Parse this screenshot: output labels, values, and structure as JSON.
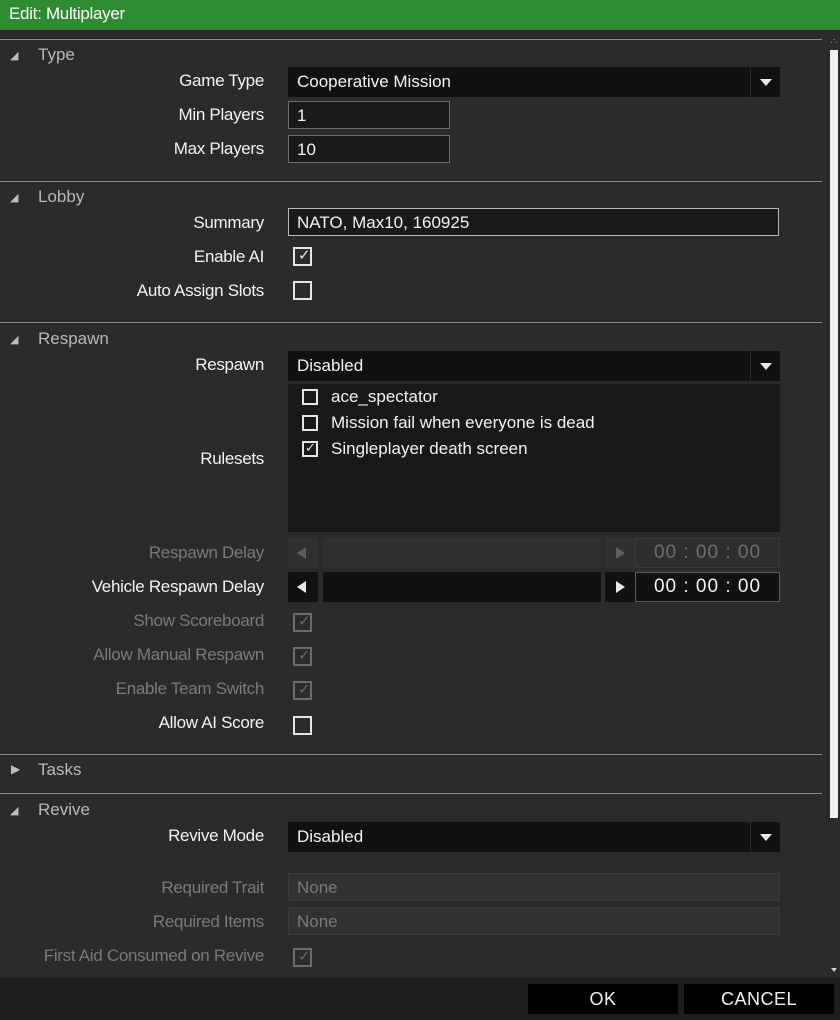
{
  "window": {
    "title": "Edit: Multiplayer"
  },
  "sections": {
    "type": {
      "title": "Type",
      "game_type_label": "Game Type",
      "game_type_value": "Cooperative Mission",
      "min_players_label": "Min Players",
      "min_players_value": "1",
      "max_players_label": "Max Players",
      "max_players_value": "10"
    },
    "lobby": {
      "title": "Lobby",
      "summary_label": "Summary",
      "summary_value": "NATO, Max10, 160925",
      "enable_ai_label": "Enable AI",
      "enable_ai_checked": true,
      "auto_assign_label": "Auto Assign Slots",
      "auto_assign_checked": false
    },
    "respawn": {
      "title": "Respawn",
      "respawn_label": "Respawn",
      "respawn_value": "Disabled",
      "rulesets_label": "Rulesets",
      "rulesets": [
        {
          "label": "ace_spectator",
          "checked": false
        },
        {
          "label": "Mission fail when everyone is dead",
          "checked": false
        },
        {
          "label": "Singleplayer death screen",
          "checked": true
        }
      ],
      "respawn_delay_label": "Respawn Delay",
      "respawn_delay_value": "00 : 00 : 00",
      "vehicle_delay_label": "Vehicle Respawn Delay",
      "vehicle_delay_value": "00 : 00 : 00",
      "show_scoreboard_label": "Show Scoreboard",
      "allow_manual_label": "Allow Manual Respawn",
      "enable_team_switch_label": "Enable Team Switch",
      "allow_ai_score_label": "Allow AI Score"
    },
    "tasks": {
      "title": "Tasks"
    },
    "revive": {
      "title": "Revive",
      "revive_mode_label": "Revive Mode",
      "revive_mode_value": "Disabled",
      "required_trait_label": "Required Trait",
      "required_trait_value": "None",
      "required_items_label": "Required Items",
      "required_items_value": "None",
      "first_aid_label": "First Aid Consumed on Revive"
    }
  },
  "footer": {
    "ok_label": "OK",
    "cancel_label": "CANCEL"
  },
  "colors": {
    "titlebar": "#2e8b32",
    "background": "#2b2b2b",
    "field": "#111111"
  },
  "icons": {
    "expanded": "triangle-down-icon",
    "collapsed": "triangle-right-icon",
    "dropdown": "chevron-down-icon",
    "check": "checkmark-icon"
  }
}
